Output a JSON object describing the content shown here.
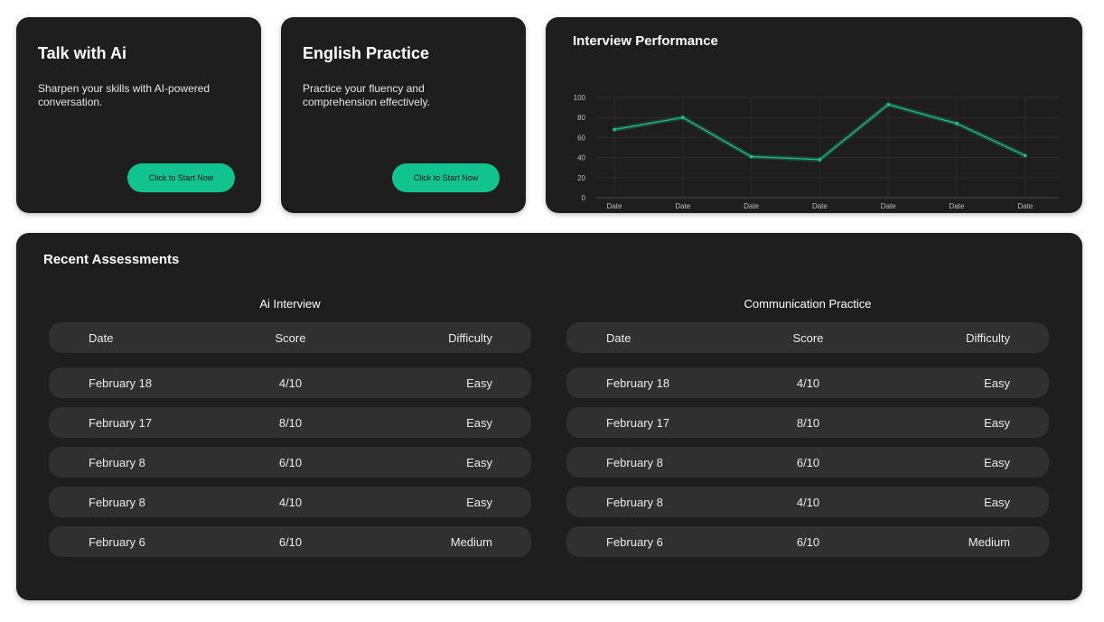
{
  "cards": [
    {
      "title": "Talk with Ai",
      "description": "Sharpen your skills with AI-powered conversation.",
      "button_label": "Click to Start Now"
    },
    {
      "title": "English Practice",
      "description": "Practice your fluency and comprehension effectively.",
      "button_label": "Click to Start Now"
    }
  ],
  "performance": {
    "title": "Interview Performance"
  },
  "chart_data": {
    "type": "line",
    "title": "Interview Performance",
    "x": [
      "Date",
      "Date",
      "Date",
      "Date",
      "Date",
      "Date",
      "Date"
    ],
    "values": [
      68,
      80,
      41,
      38,
      93,
      74,
      42
    ],
    "ylim": [
      0,
      100
    ],
    "yticks": [
      0,
      20,
      40,
      60,
      80,
      100
    ],
    "grid": true,
    "line_color": "#1fc48b"
  },
  "recent": {
    "title": "Recent Assessments",
    "tables": [
      {
        "title": "Ai Interview",
        "headers": [
          "Date",
          "Score",
          "Difficulty"
        ],
        "rows": [
          [
            "February 18",
            "4/10",
            "Easy"
          ],
          [
            "February 17",
            "8/10",
            "Easy"
          ],
          [
            "February 8",
            "6/10",
            "Easy"
          ],
          [
            "February 8",
            "4/10",
            "Easy"
          ],
          [
            "February 6",
            "6/10",
            "Medium"
          ]
        ]
      },
      {
        "title": "Communication Practice",
        "headers": [
          "Date",
          "Score",
          "Difficulty"
        ],
        "rows": [
          [
            "February 18",
            "4/10",
            "Easy"
          ],
          [
            "February 17",
            "8/10",
            "Easy"
          ],
          [
            "February 8",
            "6/10",
            "Easy"
          ],
          [
            "February 8",
            "4/10",
            "Easy"
          ],
          [
            "February 6",
            "6/10",
            "Medium"
          ]
        ]
      }
    ]
  },
  "colors": {
    "card_bg": "#1e1e1e",
    "row_bg": "#303030",
    "accent": "#11c48f"
  }
}
